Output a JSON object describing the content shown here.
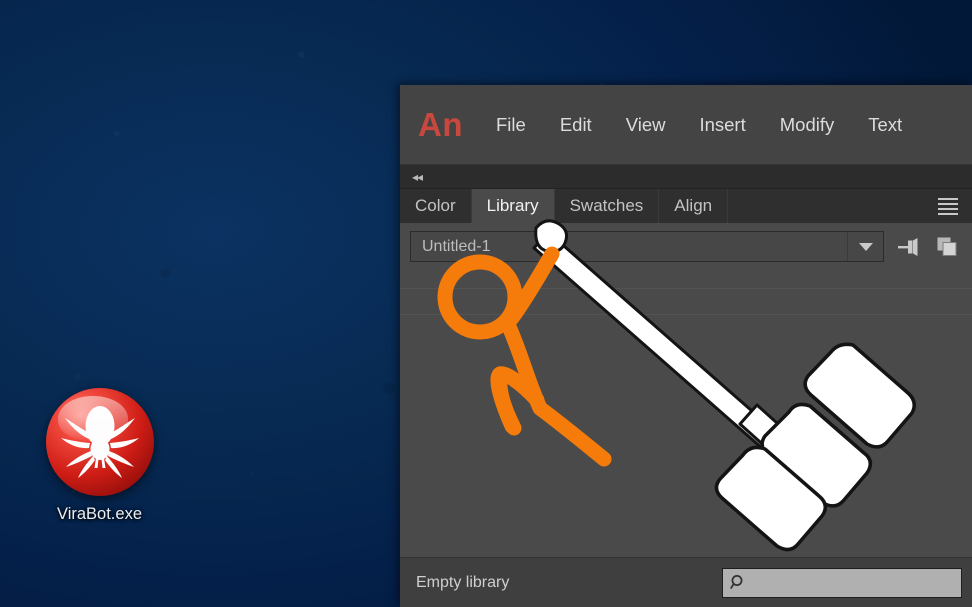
{
  "desktop": {
    "background_color": "#04204a",
    "icon": {
      "label": "ViraBot.exe",
      "glyph_name": "spider-icon",
      "badge_color": "#cf1d16"
    }
  },
  "app": {
    "name": "Adobe Animate",
    "logo_text": "An",
    "logo_color": "#c8483d",
    "menubar": {
      "items": [
        {
          "label": "File"
        },
        {
          "label": "Edit"
        },
        {
          "label": "View"
        },
        {
          "label": "Insert"
        },
        {
          "label": "Modify"
        },
        {
          "label": "Text"
        }
      ]
    },
    "collapse": {
      "icon_name": "double-chevron-left-icon",
      "glyph": "◂◂"
    },
    "panel": {
      "tabs": [
        {
          "label": "Color",
          "active": false
        },
        {
          "label": "Library",
          "active": true
        },
        {
          "label": "Swatches",
          "active": false
        },
        {
          "label": "Align",
          "active": false
        }
      ],
      "menu_icon_name": "panel-hamburger-icon",
      "toolbar": {
        "document_select_value": "Untitled-1",
        "dropdown_icon_name": "chevron-down-icon",
        "pin_button_name": "pin-library-button",
        "new_library_button_name": "new-library-button"
      },
      "status": {
        "text": "Empty library",
        "search_placeholder": "",
        "search_value": "",
        "search_icon_name": "search-icon"
      }
    }
  },
  "annotation": {
    "description": "Hand-drawn orange stick figure swinging a white cartoon mallet",
    "stroke_color": "#F57C0A",
    "mallet_fill": "#ffffff",
    "mallet_outline": "#111111"
  }
}
